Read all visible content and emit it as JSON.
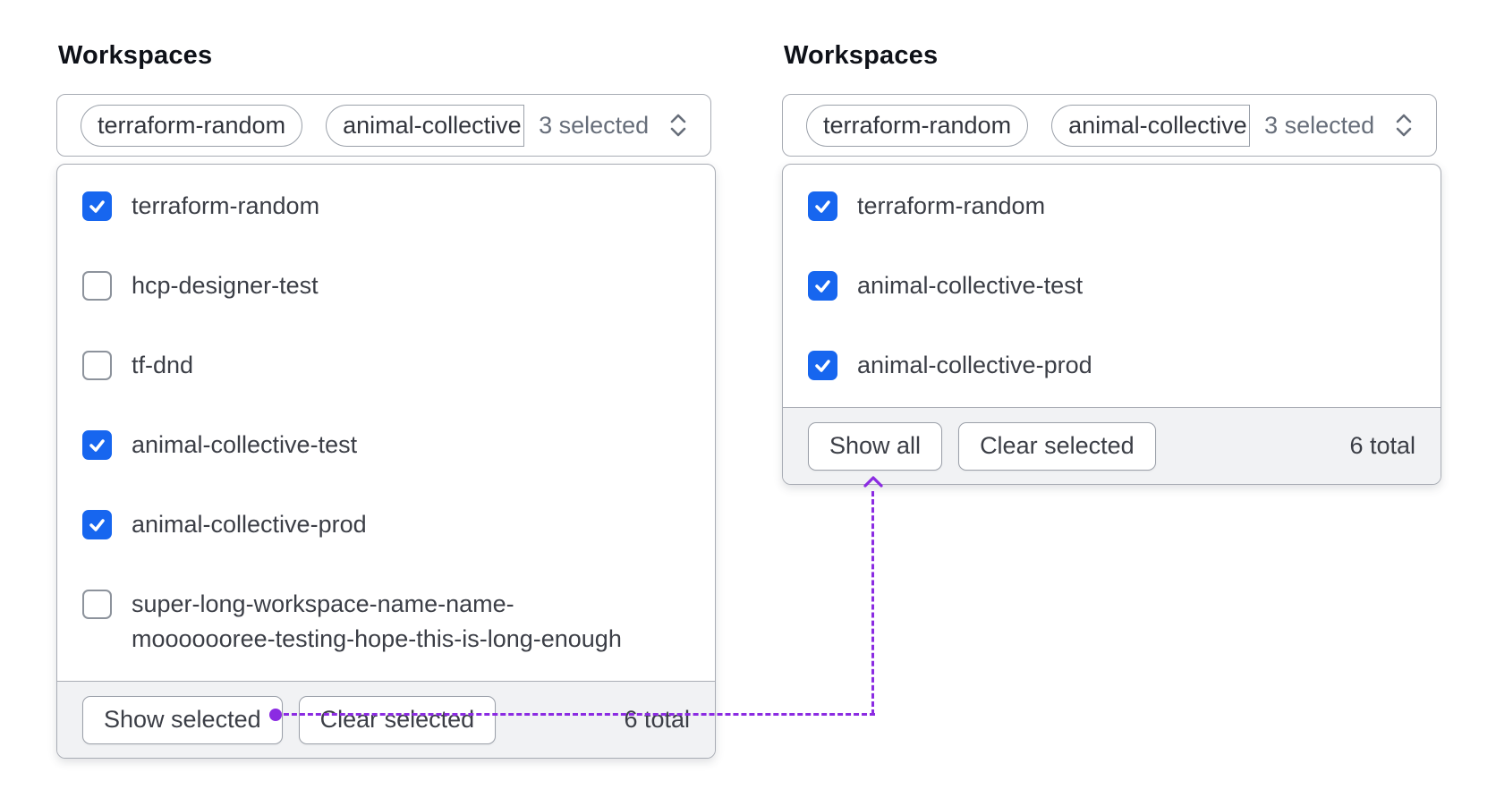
{
  "accent": {
    "checkbox_blue": "#1766ef",
    "annotation_purple": "#8b2be2"
  },
  "panels": [
    {
      "title": "Workspaces",
      "toggle": {
        "pills": [
          "terraform-random",
          "animal-collective"
        ],
        "count_label": "3 selected",
        "chevron_icon": "chevron-up-down"
      },
      "items": [
        {
          "label": "terraform-random",
          "checked": true
        },
        {
          "label": "hcp-designer-test",
          "checked": false
        },
        {
          "label": "tf-dnd",
          "checked": false
        },
        {
          "label": "animal-collective-test",
          "checked": true
        },
        {
          "label": "animal-collective-prod",
          "checked": true
        },
        {
          "label": "super-long-workspace-name-name-mooooooree-testing-hope-this-is-long-enough",
          "checked": false
        }
      ],
      "footer": {
        "buttons": [
          "Show selected",
          "Clear selected"
        ],
        "total_label": "6 total"
      }
    },
    {
      "title": "Workspaces",
      "toggle": {
        "pills": [
          "terraform-random",
          "animal-collective"
        ],
        "count_label": "3 selected",
        "chevron_icon": "chevron-up-down"
      },
      "items": [
        {
          "label": "terraform-random",
          "checked": true
        },
        {
          "label": "animal-collective-test",
          "checked": true
        },
        {
          "label": "animal-collective-prod",
          "checked": true
        }
      ],
      "footer": {
        "buttons": [
          "Show all",
          "Clear selected"
        ],
        "total_label": "6 total"
      }
    }
  ]
}
